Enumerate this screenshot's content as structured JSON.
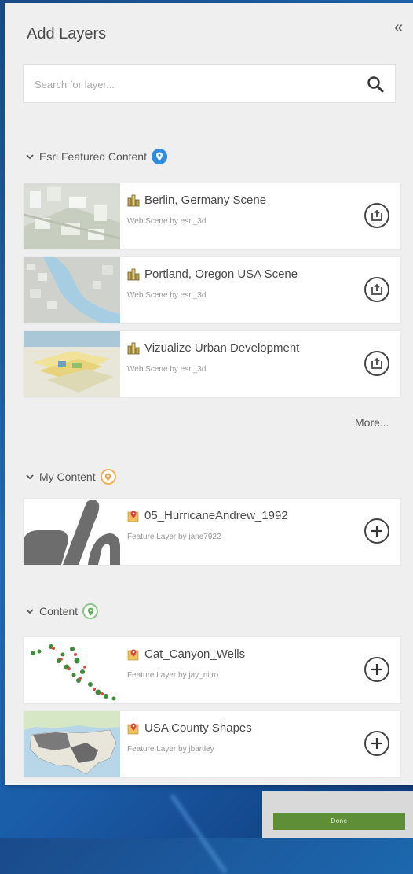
{
  "panel": {
    "title": "Add Layers",
    "collapse_glyph": "«"
  },
  "search": {
    "placeholder": "Search for layer..."
  },
  "sections": {
    "featured": {
      "label": "Esri Featured Content",
      "badge_color": "#2f8be0"
    },
    "my": {
      "label": "My Content",
      "badge_color": "#f2b25a"
    },
    "content": {
      "label": "Content",
      "badge_color": "#8bc58a"
    }
  },
  "featured_items": [
    {
      "title": "Berlin, Germany Scene",
      "subtitle": "Web Scene by esri_3d",
      "type_icon": "scene-icon",
      "action_icon": "open-scene-icon"
    },
    {
      "title": "Portland, Oregon USA Scene",
      "subtitle": "Web Scene by esri_3d",
      "type_icon": "scene-icon",
      "action_icon": "open-scene-icon"
    },
    {
      "title": "Vizualize Urban Development",
      "subtitle": "Web Scene by esri_3d",
      "type_icon": "scene-icon",
      "action_icon": "open-scene-icon"
    }
  ],
  "more_label": "More...",
  "my_items": [
    {
      "title": "05_HurricaneAndrew_1992",
      "subtitle": "Feature Layer by jane7922",
      "type_icon": "feature-layer-icon",
      "action_icon": "add-icon"
    }
  ],
  "content_items": [
    {
      "title": "Cat_Canyon_Wells",
      "subtitle": "Feature Layer by jay_nitro",
      "type_icon": "feature-layer-icon",
      "action_icon": "add-icon"
    },
    {
      "title": "USA County Shapes",
      "subtitle": "Feature Layer by jbartley",
      "type_icon": "feature-layer-icon",
      "action_icon": "add-icon"
    }
  ],
  "footer": {
    "done_label": "Done"
  },
  "colors": {
    "accent_blue": "#2f8be0",
    "done_green": "#5e8f37"
  }
}
